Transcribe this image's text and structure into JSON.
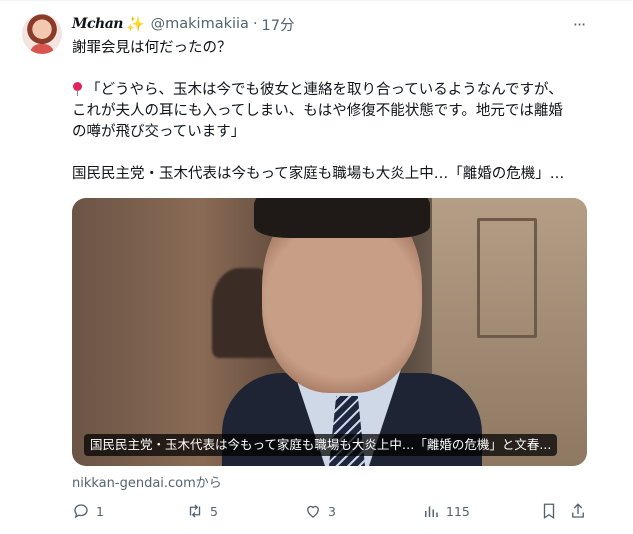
{
  "tweet": {
    "display_name": "Mchan",
    "sparkle": "✨",
    "handle": "@makimakiia",
    "separator": "·",
    "time": "17分",
    "more": "···",
    "lines": [
      "謝罪会見は何だったの？",
      "",
      "「どうやら、玉木は今でも彼女と連絡を取り合っているようなんですが、",
      "これが夫人の耳にも入ってしまい、もはや修復不能状態です。地元では離婚",
      "の噂が飛び交っています」",
      "",
      "国民民主党・玉木代表は今もって家庭も職場も大炎上中…「離婚の危機」…"
    ]
  },
  "card": {
    "caption": "国民民主党・玉木代表は今もって家庭も職場も大炎上中…「離婚の危機」と文春...",
    "source": "nikkan-gendai.comから"
  },
  "actions": {
    "reply_count": "1",
    "retweet_count": "5",
    "like_count": "3",
    "views_count": "115"
  },
  "colors": {
    "text": "#0f1419",
    "secondary": "#536471",
    "pin": "#e0245e"
  }
}
